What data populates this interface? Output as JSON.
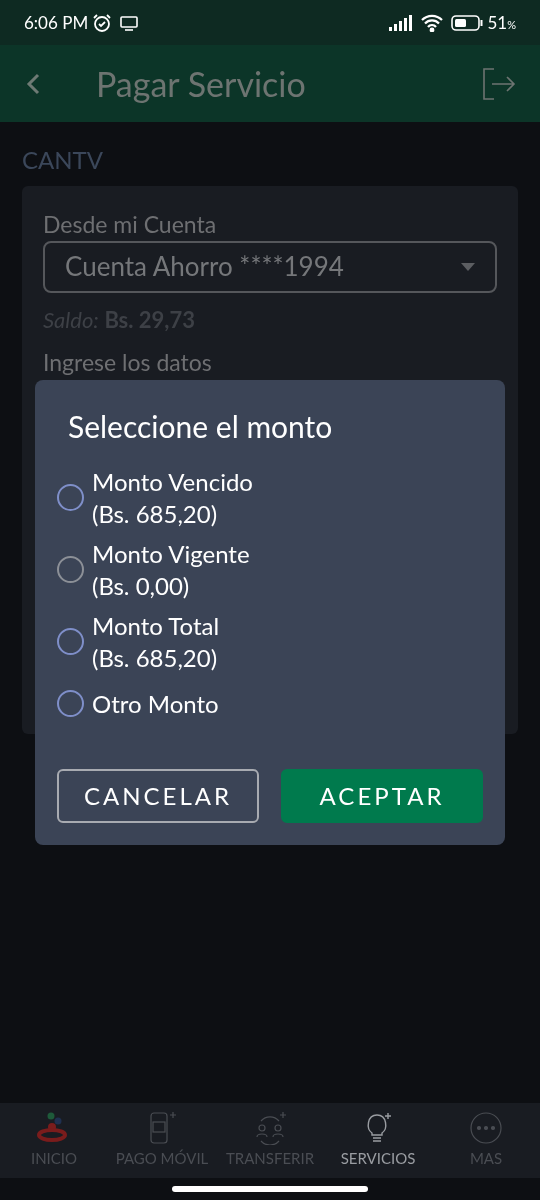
{
  "status_bar": {
    "time": "6:06 PM",
    "battery": "51",
    "battery_unit": "%"
  },
  "header": {
    "title": "Pagar Servicio"
  },
  "section_title": "CANTV",
  "form": {
    "account_label": "Desde mi Cuenta",
    "account_value": "Cuenta Ahorro ****1994",
    "balance": "*Saldo:* **Bs. 29,73**",
    "data_label": "Ingrese los datos"
  },
  "dialog": {
    "title": "Seleccione el monto",
    "options": [
      {
        "label": "Monto Vencido",
        "amount": "(Bs. 685,20)",
        "selected": false,
        "disabled": false
      },
      {
        "label": "Monto Vigente",
        "amount": "(Bs. 0,00)",
        "selected": false,
        "disabled": true
      },
      {
        "label": "Monto Total",
        "amount": "(Bs. 685,20)",
        "selected": false,
        "disabled": false
      },
      {
        "label": "Otro Monto",
        "selected": false,
        "disabled": false
      }
    ],
    "buttons": [
      {
        "label": "CANCELAR",
        "kind": "outline"
      },
      {
        "label": "ACEPTAR",
        "kind": "primary"
      }
    ]
  },
  "bottom_nav": [
    {
      "label": "INICIO",
      "kind": "home",
      "selected": false
    },
    {
      "label": "PAGO MÓVIL",
      "kind": "phone",
      "selected": false
    },
    {
      "label": "TRANSFERIR",
      "kind": "transfer",
      "selected": false
    },
    {
      "label": "SERVICIOS",
      "kind": "bulb",
      "selected": true
    },
    {
      "label": "MAS",
      "kind": "more",
      "selected": false
    }
  ]
}
